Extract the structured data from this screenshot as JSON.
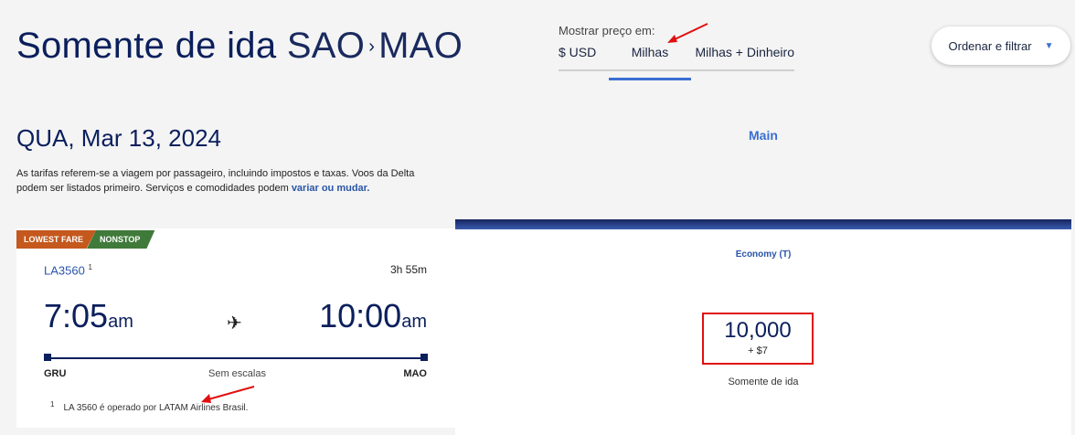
{
  "header": {
    "trip_type": "Somente de ida",
    "origin_code": "SAO",
    "arrow": "›",
    "destination_code": "MAO"
  },
  "price_toggle": {
    "label": "Mostrar preço em:",
    "options": [
      "$ USD",
      "Milhas",
      "Milhas + Dinheiro"
    ],
    "selected": "Milhas"
  },
  "sort": {
    "label": "Ordenar e filtrar"
  },
  "results": {
    "date": "QUA, Mar 13, 2024",
    "cabin_header": "Main",
    "disclaimer_text": "As tarifas referem-se a viagem por passageiro, incluindo impostos e taxas. Voos da Delta podem ser listados primeiro. Serviços e comodidades podem ",
    "disclaimer_link": "variar ou mudar."
  },
  "flight": {
    "badges": [
      "LOWEST FARE",
      "NONSTOP"
    ],
    "flight_number": "LA3560",
    "footnote_marker": "1",
    "duration": "3h 55m",
    "departure_time": "7:05",
    "departure_ampm": "am",
    "arrival_time": "10:00",
    "arrival_ampm": "am",
    "origin": "GRU",
    "destination": "MAO",
    "stops": "Sem escalas",
    "footnote": "LA 3560 é operado por LATAM Airlines Brasil."
  },
  "fare": {
    "class": "Economy (T)",
    "miles": "10,000",
    "fees": "+ $7",
    "trip": "Somente de ida"
  },
  "colors": {
    "brand_navy": "#0b1f5c",
    "link_blue": "#3a6fd1",
    "lowest_fare": "#c4581d",
    "nonstop": "#3f7a3a",
    "highlight_red": "#e01010"
  }
}
